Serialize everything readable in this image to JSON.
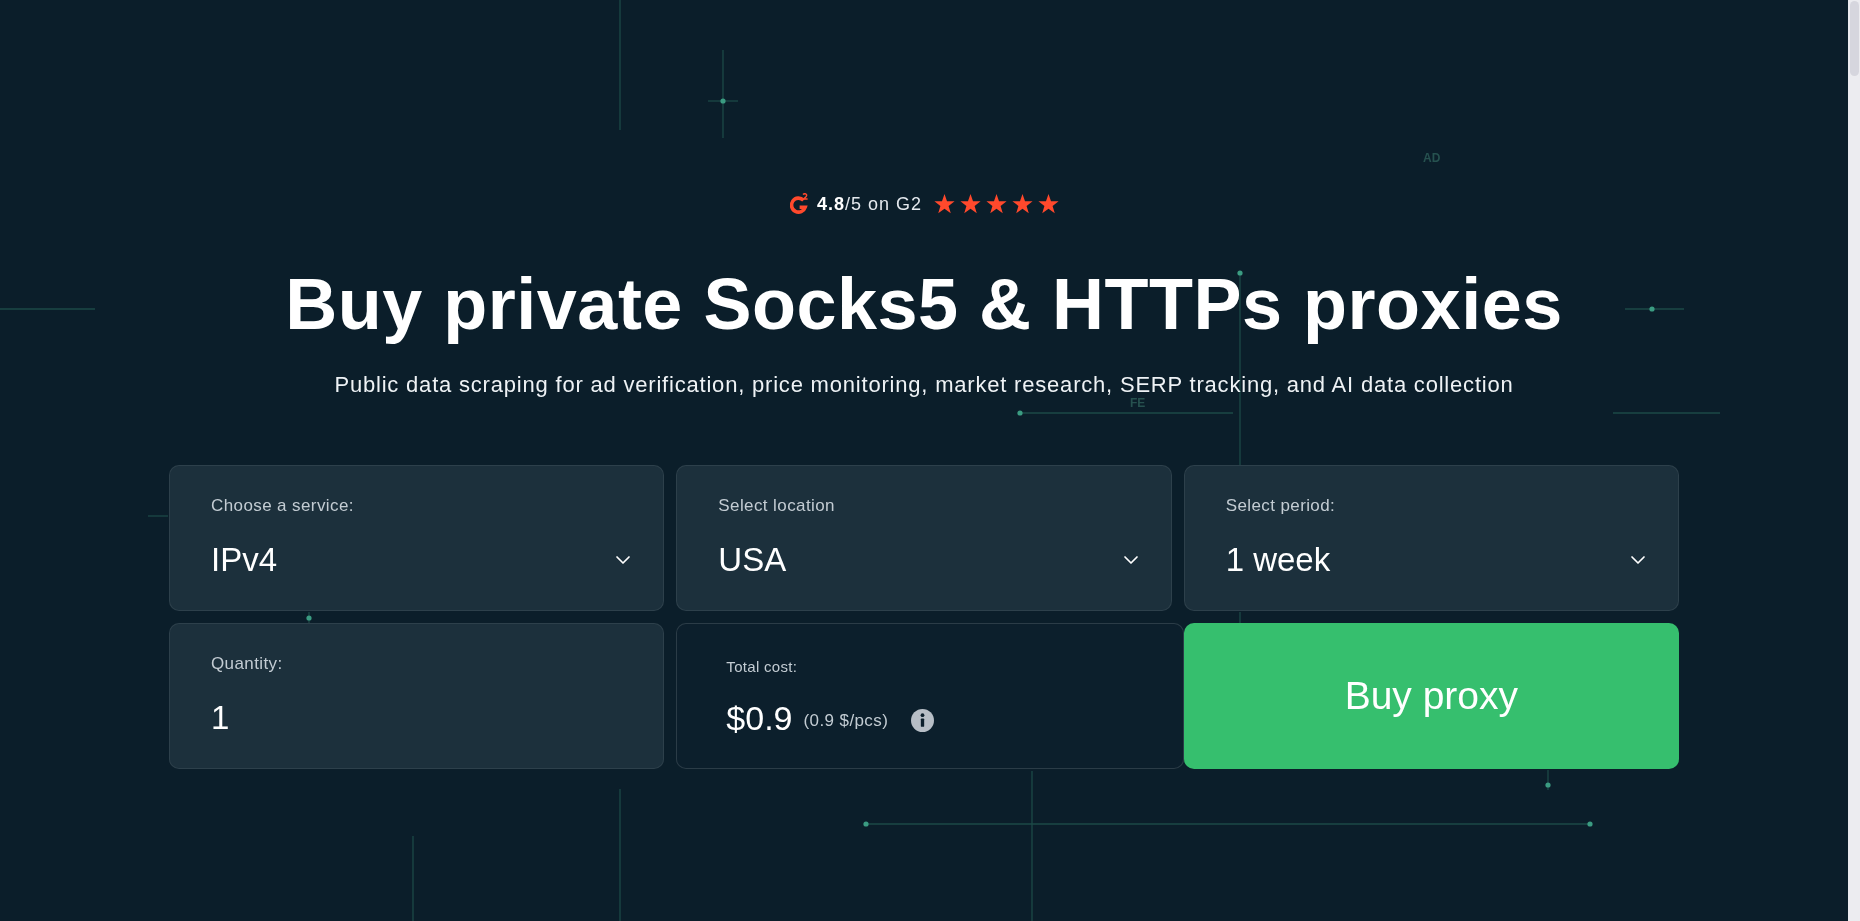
{
  "rating": {
    "text": "**4.8**/5 on G2",
    "stars": 5
  },
  "heading": "Buy private Socks5 & HTTPs proxies",
  "subheading": "Public data scraping for ad verification, price monitoring, market research, SERP tracking, and AI data collection",
  "background_labels": [
    "AD",
    "FE"
  ],
  "form": {
    "fields": [
      {
        "kind": "select",
        "label": "Choose a service:",
        "value": "IPv4"
      },
      {
        "kind": "select",
        "label": "Select location",
        "value": "USA"
      },
      {
        "kind": "select",
        "label": "Select period:",
        "value": "1 week"
      },
      {
        "kind": "input",
        "label": "Quantity:",
        "value": "1"
      }
    ],
    "total": {
      "label": "Total cost:",
      "amount": "$0.9",
      "unit_price": "(0.9 $/pcs)"
    },
    "buy_button": "Buy proxy"
  }
}
